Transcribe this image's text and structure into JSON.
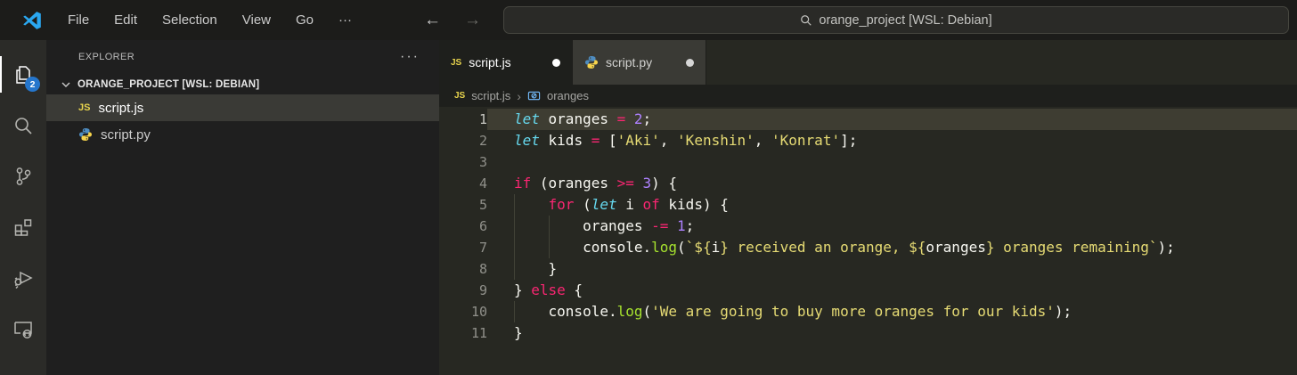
{
  "colors": {
    "editor_bg": "#272822",
    "active_line": "#3e3d32",
    "keyword_pink": "#f92672",
    "storage_blue": "#66d9ef",
    "string_yellow": "#e6db74",
    "number_purple": "#ae81ff",
    "function_green": "#a6e22e",
    "badge_blue": "#2576cc",
    "js_icon_yellow": "#e8d44d"
  },
  "title_bar": {
    "menus": [
      "File",
      "Edit",
      "Selection",
      "View",
      "Go"
    ],
    "more": "···",
    "back_arrow": "←",
    "forward_arrow": "→",
    "search_text": "orange_project [WSL: Debian]"
  },
  "activity_bar": {
    "items": [
      {
        "icon": "explorer-icon",
        "active": true,
        "badge": "2"
      },
      {
        "icon": "search-icon"
      },
      {
        "icon": "source-control-icon"
      },
      {
        "icon": "extensions-icon"
      },
      {
        "icon": "run-debug-icon"
      },
      {
        "icon": "remote-explorer-icon"
      }
    ]
  },
  "sidebar": {
    "title": "EXPLORER",
    "more": "···",
    "workspace": "ORANGE_PROJECT [WSL: DEBIAN]",
    "files": [
      {
        "name": "script.js",
        "icon": "js-file-icon",
        "selected": true
      },
      {
        "name": "script.py",
        "icon": "python-file-icon",
        "selected": false
      }
    ]
  },
  "editor": {
    "tabs": [
      {
        "label": "script.js",
        "icon": "js-file-icon",
        "modified": true,
        "active": true
      },
      {
        "label": "script.py",
        "icon": "python-file-icon",
        "modified": true,
        "active": false
      }
    ],
    "breadcrumb": {
      "file": "script.js",
      "separator": "›",
      "symbol": "oranges",
      "symbol_icon": "variable-symbol-icon"
    },
    "code": {
      "language": "javascript",
      "lines": [
        {
          "n": "1",
          "active": true,
          "guides": 0,
          "tokens": [
            [
              "st",
              "let"
            ],
            [
              "fg",
              " oranges "
            ],
            [
              "kw",
              "="
            ],
            [
              "fg",
              " "
            ],
            [
              "num",
              "2"
            ],
            [
              "fg",
              ";"
            ]
          ]
        },
        {
          "n": "2",
          "guides": 0,
          "tokens": [
            [
              "st",
              "let"
            ],
            [
              "fg",
              " kids "
            ],
            [
              "kw",
              "="
            ],
            [
              "fg",
              " ["
            ],
            [
              "str",
              "'Aki'"
            ],
            [
              "fg",
              ", "
            ],
            [
              "str",
              "'Kenshin'"
            ],
            [
              "fg",
              ", "
            ],
            [
              "str",
              "'Konrat'"
            ],
            [
              "fg",
              "];"
            ]
          ]
        },
        {
          "n": "3",
          "guides": 0,
          "tokens": []
        },
        {
          "n": "4",
          "guides": 0,
          "tokens": [
            [
              "kw",
              "if"
            ],
            [
              "fg",
              " (oranges "
            ],
            [
              "kw",
              ">="
            ],
            [
              "fg",
              " "
            ],
            [
              "num",
              "3"
            ],
            [
              "fg",
              ") {"
            ]
          ]
        },
        {
          "n": "5",
          "guides": 1,
          "tokens": [
            [
              "fg",
              "    "
            ],
            [
              "kw",
              "for"
            ],
            [
              "fg",
              " ("
            ],
            [
              "st",
              "let"
            ],
            [
              "fg",
              " i "
            ],
            [
              "kw",
              "of"
            ],
            [
              "fg",
              " kids) {"
            ]
          ]
        },
        {
          "n": "6",
          "guides": 2,
          "tokens": [
            [
              "fg",
              "        oranges "
            ],
            [
              "kw",
              "-="
            ],
            [
              "fg",
              " "
            ],
            [
              "num",
              "1"
            ],
            [
              "fg",
              ";"
            ]
          ]
        },
        {
          "n": "7",
          "guides": 2,
          "tokens": [
            [
              "fg",
              "        console."
            ],
            [
              "fn",
              "log"
            ],
            [
              "fg",
              "("
            ],
            [
              "str",
              "`${"
            ],
            [
              "fg",
              "i"
            ],
            [
              "str",
              "} received an orange, ${"
            ],
            [
              "fg",
              "oranges"
            ],
            [
              "str",
              "} oranges remaining`"
            ],
            [
              "fg",
              ");"
            ]
          ]
        },
        {
          "n": "8",
          "guides": 1,
          "tokens": [
            [
              "fg",
              "    }"
            ]
          ]
        },
        {
          "n": "9",
          "guides": 0,
          "tokens": [
            [
              "fg",
              "} "
            ],
            [
              "kw",
              "else"
            ],
            [
              "fg",
              " {"
            ]
          ]
        },
        {
          "n": "10",
          "guides": 1,
          "tokens": [
            [
              "fg",
              "    console."
            ],
            [
              "fn",
              "log"
            ],
            [
              "fg",
              "("
            ],
            [
              "str",
              "'We are going to buy more oranges for our kids'"
            ],
            [
              "fg",
              ");"
            ]
          ]
        },
        {
          "n": "11",
          "guides": 0,
          "tokens": [
            [
              "fg",
              "}"
            ]
          ]
        }
      ]
    }
  }
}
